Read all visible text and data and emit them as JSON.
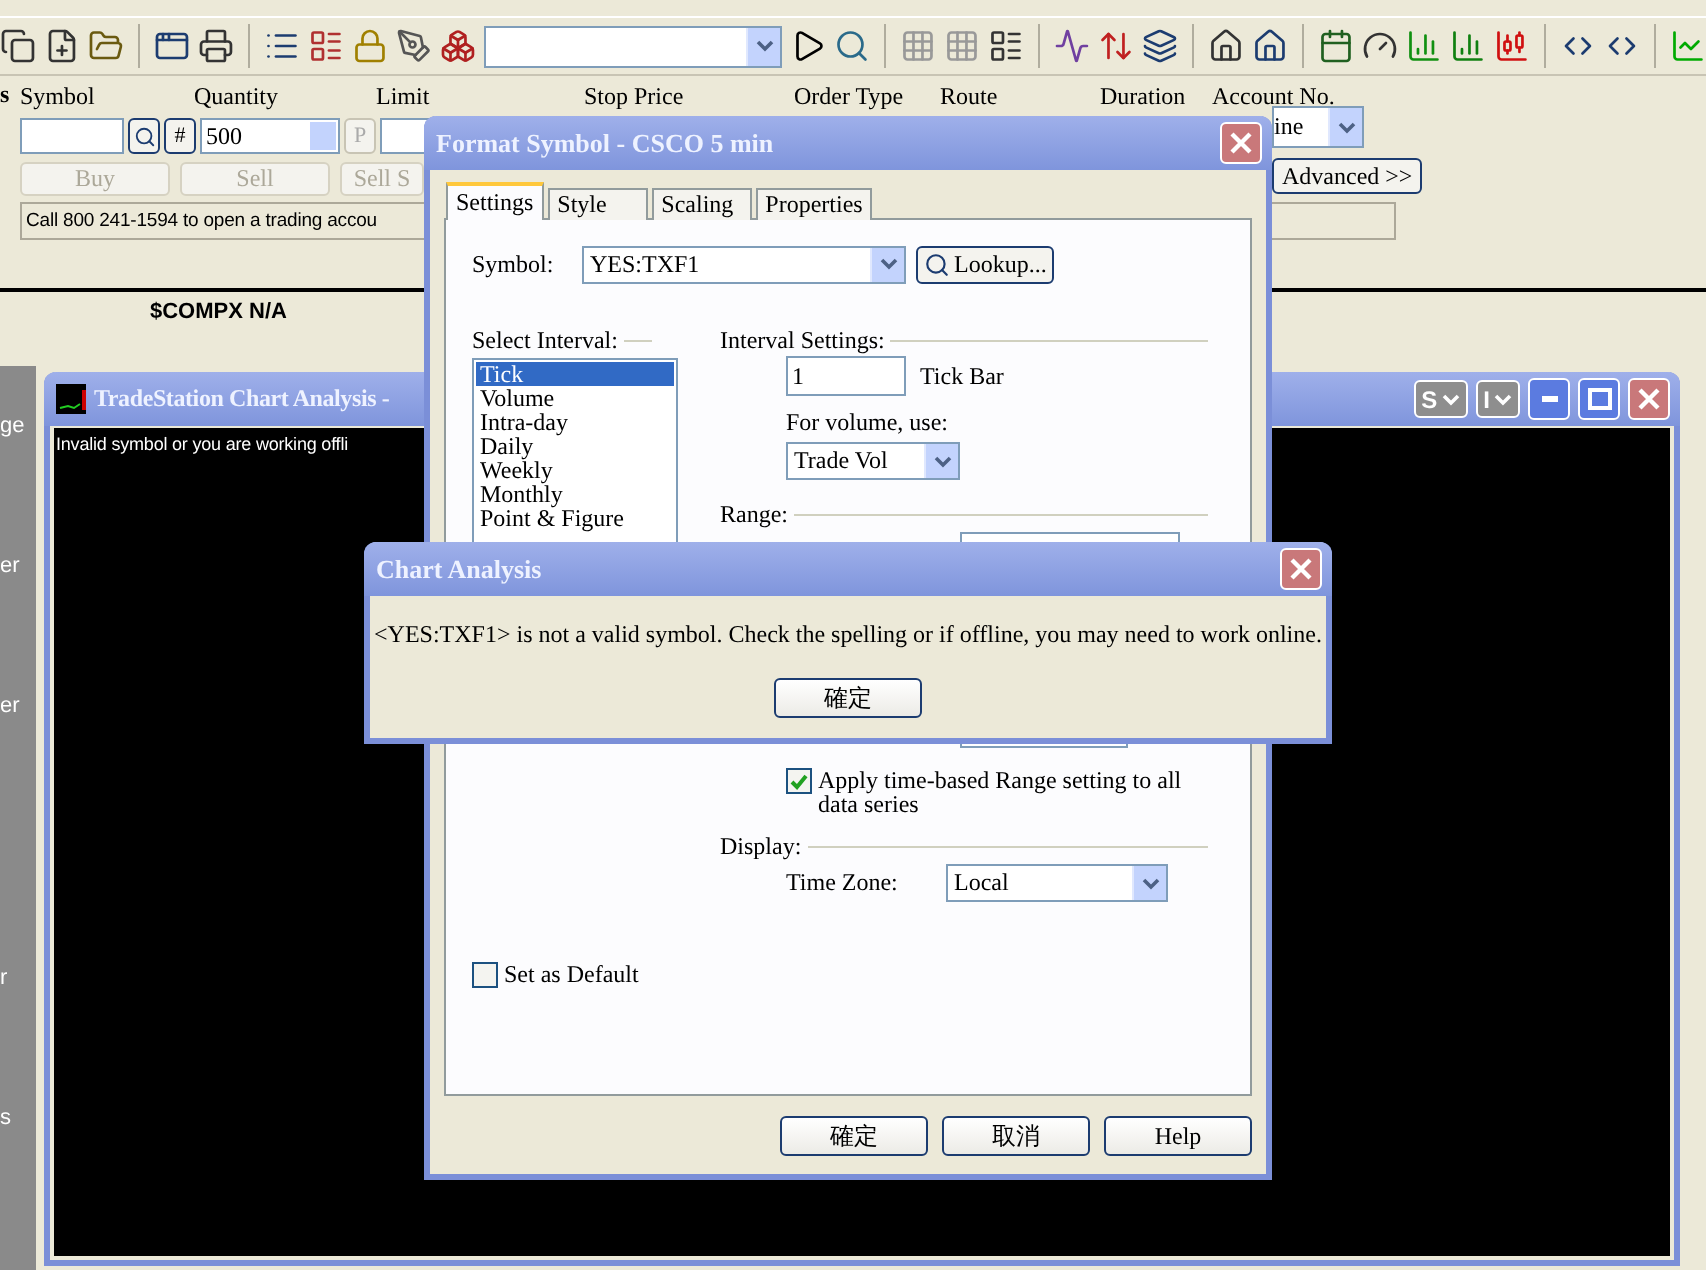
{
  "order_bar": {
    "edge_label": "s",
    "labels": [
      "Symbol",
      "Quantity",
      "Limit",
      "Stop Price",
      "Order Type",
      "Route",
      "Duration",
      "Account No."
    ],
    "hash_button": "#",
    "quantity": "500",
    "p_button": "P",
    "buttons": [
      {
        "label": "Buy",
        "disabled": true
      },
      {
        "label": "Sell",
        "disabled": true
      },
      {
        "label": "Sell S",
        "disabled": true
      }
    ],
    "account_value": "ine",
    "advanced_button": "Advanced >>",
    "info": "Call 800 241-1594 to open a trading accou"
  },
  "ticker": "$COMPX N/A",
  "left_panel": [
    "ge",
    "er",
    "er",
    "r",
    "s"
  ],
  "chart_window": {
    "title": "TradeStation Chart Analysis -",
    "message": "Invalid symbol or you are working offli",
    "menu_buttons": [
      "S",
      "I"
    ]
  },
  "format_dialog": {
    "title": "Format Symbol - CSCO  5 min",
    "tabs": [
      {
        "label": "Settings",
        "selected": true
      },
      {
        "label": "Style",
        "selected": false
      },
      {
        "label": "Scaling",
        "selected": false
      },
      {
        "label": "Properties",
        "selected": false
      }
    ],
    "symbol_label": "Symbol:",
    "symbol_value": "YES:TXF1",
    "lookup_button": "Lookup...",
    "interval_heading": "Select Interval:",
    "intervals": [
      {
        "label": "Tick",
        "selected": true
      },
      {
        "label": "Volume",
        "selected": false
      },
      {
        "label": "Intra-day",
        "selected": false
      },
      {
        "label": "Daily",
        "selected": false
      },
      {
        "label": "Weekly",
        "selected": false
      },
      {
        "label": "Monthly",
        "selected": false
      },
      {
        "label": "Point & Figure",
        "selected": false
      }
    ],
    "settings_heading": "Interval Settings:",
    "interval_value": "1",
    "interval_unit": "Tick Bar",
    "volume_label": "For volume, use:",
    "volume_value": "Trade Vol",
    "range_heading": "Range:",
    "apply_range": {
      "label": "Apply time-based Range setting to all data series",
      "checked": true
    },
    "display_heading": "Display:",
    "timezone_label": "Time Zone:",
    "timezone_value": "Local",
    "set_default": {
      "label": "Set as Default",
      "checked": false
    },
    "buttons": [
      "確定",
      "取消",
      "Help"
    ]
  },
  "message_box": {
    "title": "Chart Analysis",
    "message": "<YES:TXF1> is not a valid symbol. Check the spelling or if offline, you may need to work online.",
    "button": "確定"
  }
}
